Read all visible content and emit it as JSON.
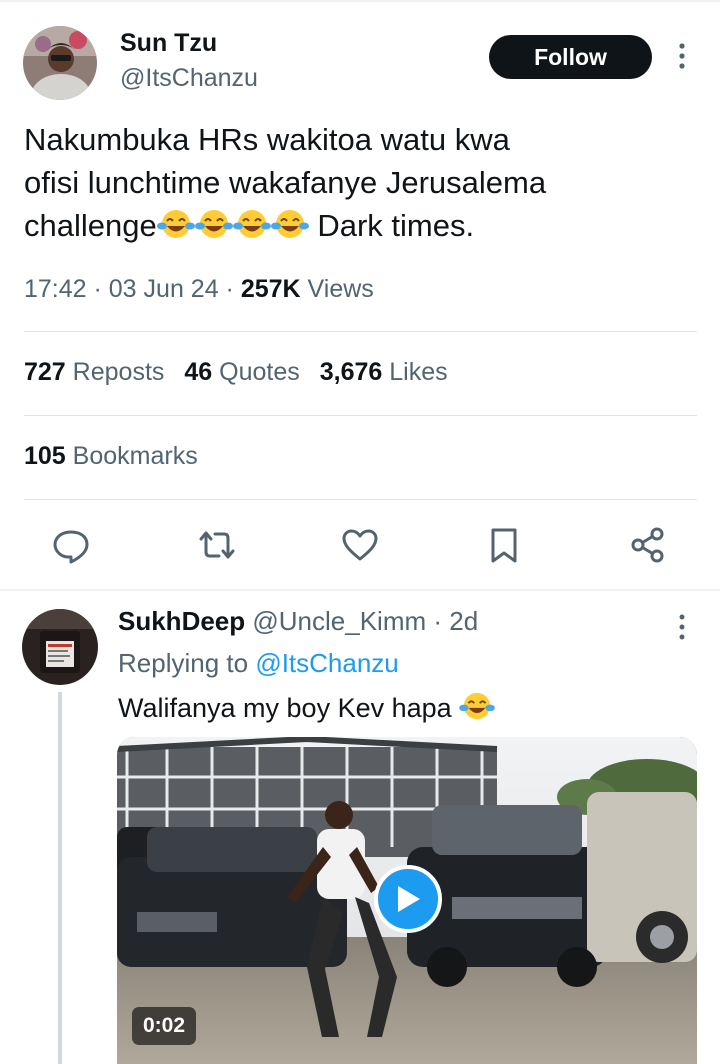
{
  "tweet": {
    "author_name": "Sun Tzu",
    "author_handle": "@ItsChanzu",
    "follow_label": "Follow",
    "text_line1": "Nakumbuka HRs wakitoa watu kwa",
    "text_line2": "ofisi lunchtime wakafanye Jerusalema",
    "text_line3_start": "challenge",
    "text_line3_end": " Dark times.",
    "emoji": "face-with-tears-of-joy",
    "time": "17:42",
    "date": "03 Jun 24",
    "views_count": "257K",
    "views_label": "Views",
    "separator": " · "
  },
  "stats": {
    "reposts_count": "727",
    "reposts_label": "Reposts",
    "quotes_count": "46",
    "quotes_label": "Quotes",
    "likes_count": "3,676",
    "likes_label": "Likes",
    "bookmarks_count": "105",
    "bookmarks_label": "Bookmarks"
  },
  "actions": [
    "reply-icon",
    "repost-icon",
    "like-icon",
    "bookmark-icon",
    "share-icon"
  ],
  "reply": {
    "author_name": "SukhDeep",
    "author_handle": "@Uncle_Kimm",
    "age": "· 2d",
    "replying_prefix": "Replying to ",
    "replying_to": "@ItsChanzu",
    "text": "Walifanya my boy Kev hapa",
    "video_duration": "0:02"
  },
  "colors": {
    "accent": "#1d9bf0",
    "text_primary": "#0f1419",
    "text_secondary": "#536471",
    "divider": "#e1e5e8"
  }
}
